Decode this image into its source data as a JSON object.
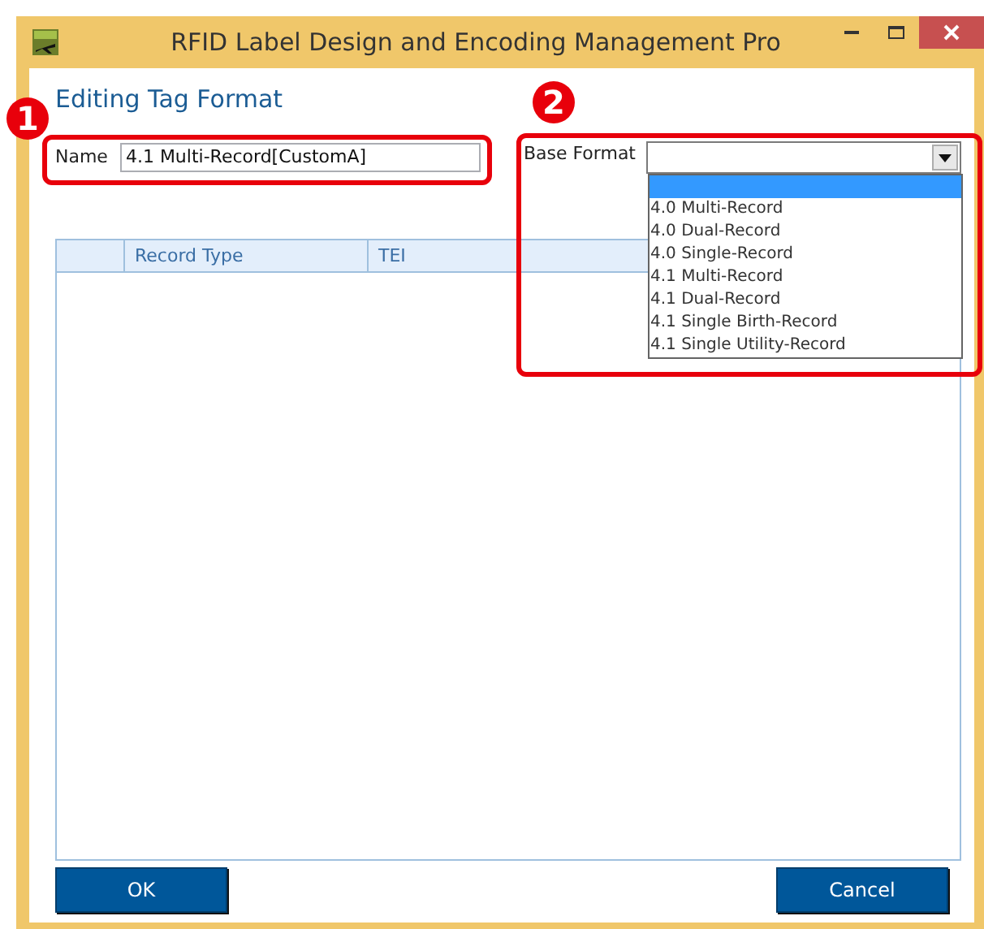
{
  "window": {
    "title": "RFID Label Design and Encoding Management Pro"
  },
  "heading": "Editing Tag Format",
  "name_field": {
    "label": "Name",
    "value": "4.1 Multi-Record[CustomA]"
  },
  "base_format": {
    "label": "Base Format",
    "expanded": true,
    "blank_item_selected": true,
    "items": [
      {
        "label": "4.0 Multi-Record",
        "selected": false
      },
      {
        "label": "4.0 Dual-Record",
        "selected": false
      },
      {
        "label": "4.0 Single-Record",
        "selected": false
      },
      {
        "label": "4.1 Multi-Record",
        "selected": false
      },
      {
        "label": "4.1 Dual-Record",
        "selected": false
      },
      {
        "label": "4.1 Single Birth-Record",
        "selected": false
      },
      {
        "label": "4.1 Single Utility-Record",
        "selected": false
      }
    ]
  },
  "table": {
    "columns": [
      "Record Type",
      "TEI"
    ]
  },
  "buttons": [
    "OK",
    "Cancel"
  ],
  "annotations": [
    "1",
    "2"
  ]
}
